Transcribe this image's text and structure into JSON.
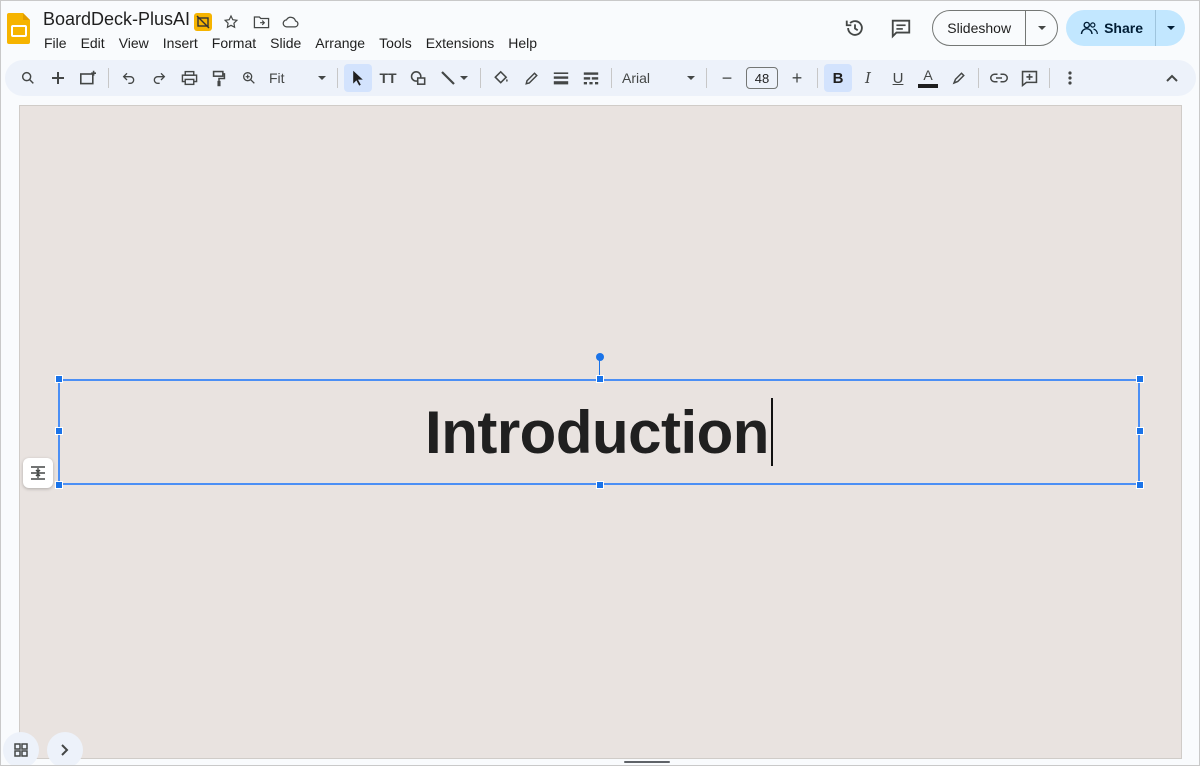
{
  "app": {
    "name": "Google Slides"
  },
  "document": {
    "title": "BoardDeck-PlusAI"
  },
  "menu": [
    "File",
    "Edit",
    "View",
    "Insert",
    "Format",
    "Slide",
    "Arrange",
    "Tools",
    "Extensions",
    "Help"
  ],
  "header": {
    "slideshow_label": "Slideshow",
    "share_label": "Share"
  },
  "toolbar": {
    "zoom_value": "Fit",
    "font_family": "Arial",
    "font_size": "48",
    "bold_label": "B",
    "italic_label": "I",
    "underline_label": "U",
    "text_color_label": "A",
    "text_tool_label": "TT",
    "minus_label": "−",
    "plus_label": "+"
  },
  "slide": {
    "title_text": "Introduction",
    "background": "#e9e3e0"
  },
  "colors": {
    "accent": "#1a73e8",
    "share_bg": "#c2e7ff",
    "toolbar_bg": "#edf2fa"
  }
}
